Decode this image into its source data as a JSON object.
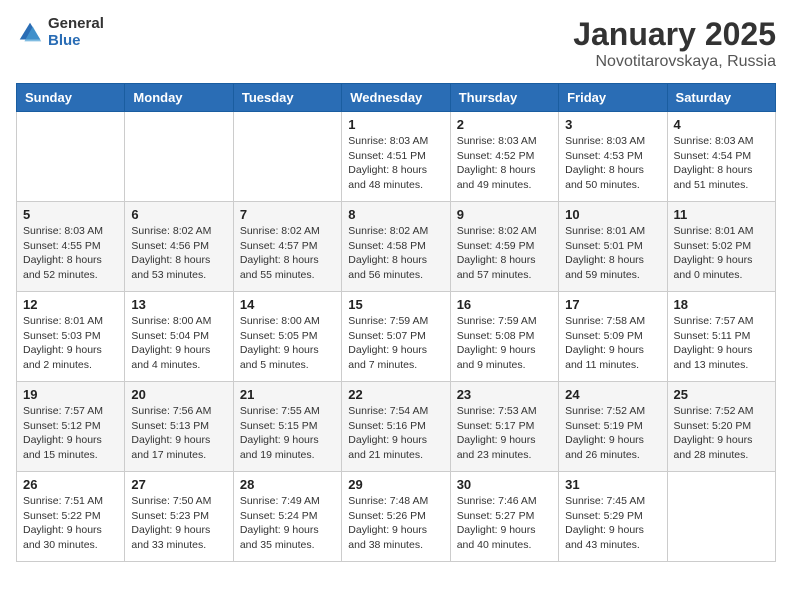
{
  "header": {
    "logo_general": "General",
    "logo_blue": "Blue",
    "title": "January 2025",
    "subtitle": "Novotitarovskaya, Russia"
  },
  "weekdays": [
    "Sunday",
    "Monday",
    "Tuesday",
    "Wednesday",
    "Thursday",
    "Friday",
    "Saturday"
  ],
  "weeks": [
    [
      {
        "day": "",
        "info": ""
      },
      {
        "day": "",
        "info": ""
      },
      {
        "day": "",
        "info": ""
      },
      {
        "day": "1",
        "info": "Sunrise: 8:03 AM\nSunset: 4:51 PM\nDaylight: 8 hours\nand 48 minutes."
      },
      {
        "day": "2",
        "info": "Sunrise: 8:03 AM\nSunset: 4:52 PM\nDaylight: 8 hours\nand 49 minutes."
      },
      {
        "day": "3",
        "info": "Sunrise: 8:03 AM\nSunset: 4:53 PM\nDaylight: 8 hours\nand 50 minutes."
      },
      {
        "day": "4",
        "info": "Sunrise: 8:03 AM\nSunset: 4:54 PM\nDaylight: 8 hours\nand 51 minutes."
      }
    ],
    [
      {
        "day": "5",
        "info": "Sunrise: 8:03 AM\nSunset: 4:55 PM\nDaylight: 8 hours\nand 52 minutes."
      },
      {
        "day": "6",
        "info": "Sunrise: 8:02 AM\nSunset: 4:56 PM\nDaylight: 8 hours\nand 53 minutes."
      },
      {
        "day": "7",
        "info": "Sunrise: 8:02 AM\nSunset: 4:57 PM\nDaylight: 8 hours\nand 55 minutes."
      },
      {
        "day": "8",
        "info": "Sunrise: 8:02 AM\nSunset: 4:58 PM\nDaylight: 8 hours\nand 56 minutes."
      },
      {
        "day": "9",
        "info": "Sunrise: 8:02 AM\nSunset: 4:59 PM\nDaylight: 8 hours\nand 57 minutes."
      },
      {
        "day": "10",
        "info": "Sunrise: 8:01 AM\nSunset: 5:01 PM\nDaylight: 8 hours\nand 59 minutes."
      },
      {
        "day": "11",
        "info": "Sunrise: 8:01 AM\nSunset: 5:02 PM\nDaylight: 9 hours\nand 0 minutes."
      }
    ],
    [
      {
        "day": "12",
        "info": "Sunrise: 8:01 AM\nSunset: 5:03 PM\nDaylight: 9 hours\nand 2 minutes."
      },
      {
        "day": "13",
        "info": "Sunrise: 8:00 AM\nSunset: 5:04 PM\nDaylight: 9 hours\nand 4 minutes."
      },
      {
        "day": "14",
        "info": "Sunrise: 8:00 AM\nSunset: 5:05 PM\nDaylight: 9 hours\nand 5 minutes."
      },
      {
        "day": "15",
        "info": "Sunrise: 7:59 AM\nSunset: 5:07 PM\nDaylight: 9 hours\nand 7 minutes."
      },
      {
        "day": "16",
        "info": "Sunrise: 7:59 AM\nSunset: 5:08 PM\nDaylight: 9 hours\nand 9 minutes."
      },
      {
        "day": "17",
        "info": "Sunrise: 7:58 AM\nSunset: 5:09 PM\nDaylight: 9 hours\nand 11 minutes."
      },
      {
        "day": "18",
        "info": "Sunrise: 7:57 AM\nSunset: 5:11 PM\nDaylight: 9 hours\nand 13 minutes."
      }
    ],
    [
      {
        "day": "19",
        "info": "Sunrise: 7:57 AM\nSunset: 5:12 PM\nDaylight: 9 hours\nand 15 minutes."
      },
      {
        "day": "20",
        "info": "Sunrise: 7:56 AM\nSunset: 5:13 PM\nDaylight: 9 hours\nand 17 minutes."
      },
      {
        "day": "21",
        "info": "Sunrise: 7:55 AM\nSunset: 5:15 PM\nDaylight: 9 hours\nand 19 minutes."
      },
      {
        "day": "22",
        "info": "Sunrise: 7:54 AM\nSunset: 5:16 PM\nDaylight: 9 hours\nand 21 minutes."
      },
      {
        "day": "23",
        "info": "Sunrise: 7:53 AM\nSunset: 5:17 PM\nDaylight: 9 hours\nand 23 minutes."
      },
      {
        "day": "24",
        "info": "Sunrise: 7:52 AM\nSunset: 5:19 PM\nDaylight: 9 hours\nand 26 minutes."
      },
      {
        "day": "25",
        "info": "Sunrise: 7:52 AM\nSunset: 5:20 PM\nDaylight: 9 hours\nand 28 minutes."
      }
    ],
    [
      {
        "day": "26",
        "info": "Sunrise: 7:51 AM\nSunset: 5:22 PM\nDaylight: 9 hours\nand 30 minutes."
      },
      {
        "day": "27",
        "info": "Sunrise: 7:50 AM\nSunset: 5:23 PM\nDaylight: 9 hours\nand 33 minutes."
      },
      {
        "day": "28",
        "info": "Sunrise: 7:49 AM\nSunset: 5:24 PM\nDaylight: 9 hours\nand 35 minutes."
      },
      {
        "day": "29",
        "info": "Sunrise: 7:48 AM\nSunset: 5:26 PM\nDaylight: 9 hours\nand 38 minutes."
      },
      {
        "day": "30",
        "info": "Sunrise: 7:46 AM\nSunset: 5:27 PM\nDaylight: 9 hours\nand 40 minutes."
      },
      {
        "day": "31",
        "info": "Sunrise: 7:45 AM\nSunset: 5:29 PM\nDaylight: 9 hours\nand 43 minutes."
      },
      {
        "day": "",
        "info": ""
      }
    ]
  ]
}
